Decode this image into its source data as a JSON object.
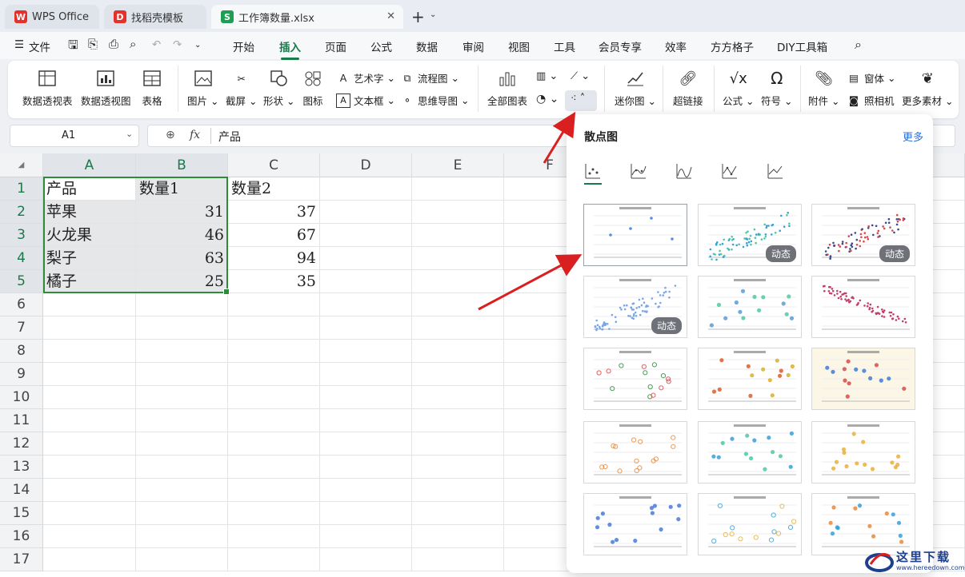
{
  "tabs": [
    {
      "label": "WPS Office"
    },
    {
      "label": "找稻壳模板"
    },
    {
      "label": "工作簿数量.xlsx"
    }
  ],
  "menu": {
    "file": "文件",
    "items": [
      "开始",
      "插入",
      "页面",
      "公式",
      "数据",
      "审阅",
      "视图",
      "工具",
      "会员专享",
      "效率",
      "方方格子",
      "DIY工具箱"
    ]
  },
  "ribbon": {
    "pivot_table": "数据透视表",
    "pivot_chart": "数据透视图",
    "table": "表格",
    "picture": "图片",
    "screenshot": "截屏",
    "shape": "形状",
    "icon": "图标",
    "art_text": "艺术字",
    "text_box": "文本框",
    "flowchart": "流程图",
    "mindmap": "思维导图",
    "all_charts": "全部图表",
    "sparkline": "迷你图",
    "hyperlink": "超链接",
    "formula": "公式",
    "symbol": "符号",
    "attachment": "附件",
    "camera": "照相机",
    "window": "窗体",
    "more_material": "更多素材"
  },
  "namebox": {
    "value": "A1"
  },
  "formula": {
    "fx": "fx",
    "value": "产品"
  },
  "columns": [
    "A",
    "B",
    "C",
    "D",
    "E",
    "F"
  ],
  "rows": [
    "1",
    "2",
    "3",
    "4",
    "5",
    "6",
    "7",
    "8",
    "9",
    "10",
    "11",
    "12",
    "13",
    "14",
    "15",
    "16",
    "17"
  ],
  "cells": [
    [
      "产品",
      "数量1",
      "数量2"
    ],
    [
      "苹果",
      "31",
      "37"
    ],
    [
      "火龙果",
      "46",
      "67"
    ],
    [
      "梨子",
      "63",
      "94"
    ],
    [
      "橘子",
      "25",
      "35"
    ]
  ],
  "panel": {
    "title": "散点图",
    "more": "更多",
    "badge": "动态"
  },
  "watermark": {
    "text": "这里下载",
    "url": "www.hereedown.com"
  },
  "colors": {
    "accent": "#1a7a4a",
    "selection": "#2e8b3a",
    "link": "#2a6fd6",
    "arrow": "#d91f1f"
  }
}
